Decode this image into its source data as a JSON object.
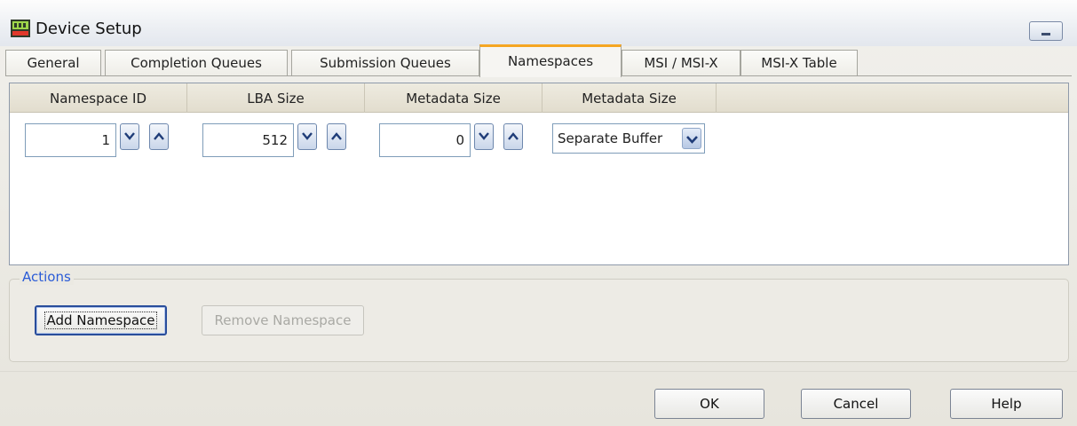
{
  "window": {
    "title": "Device Setup"
  },
  "tabs": [
    {
      "label": "General",
      "active": false
    },
    {
      "label": "Completion Queues",
      "active": false
    },
    {
      "label": "Submission Queues",
      "active": false
    },
    {
      "label": "Namespaces",
      "active": true
    },
    {
      "label": "MSI / MSI-X",
      "active": false
    },
    {
      "label": "MSI-X Table",
      "active": false
    }
  ],
  "grid": {
    "columns": [
      "Namespace ID",
      "LBA Size",
      "Metadata Size",
      "Metadata Size"
    ],
    "rows": [
      {
        "namespace_id": "1",
        "lba_size": "512",
        "metadata_size": "0",
        "metadata_mode": "Separate Buffer"
      }
    ]
  },
  "actions": {
    "label": "Actions",
    "add_label": "Add Namespace",
    "remove_label": "Remove Namespace"
  },
  "footer": {
    "ok_label": "OK",
    "cancel_label": "Cancel",
    "help_label": "Help"
  },
  "colors": {
    "active_tab_accent": "#f5a623",
    "group_label": "#2a5bd7",
    "disabled_text": "#a9a9a4"
  },
  "icons": {
    "app": "device-setup-icon",
    "minimize": "minimize-icon",
    "spin_down": "chevron-down-icon",
    "spin_up": "chevron-up-icon",
    "dropdown": "chevron-down-icon"
  }
}
